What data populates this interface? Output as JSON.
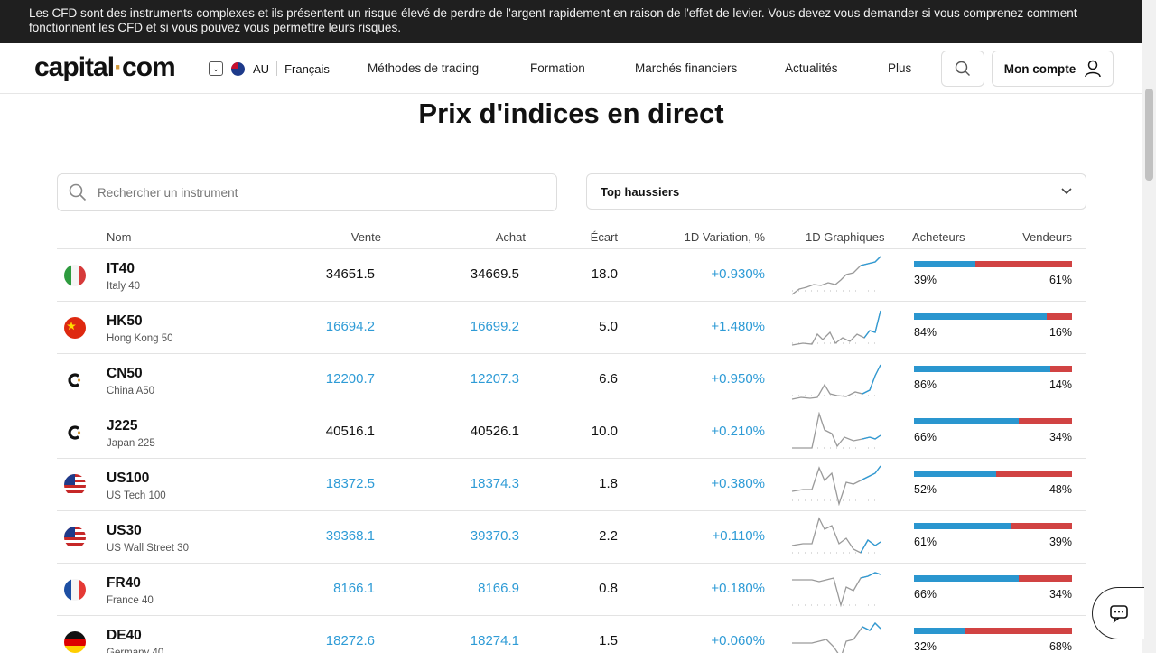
{
  "banner": {
    "text": "Les CFD sont des instruments complexes et ils présentent un risque élevé de perdre de l'argent rapidement en raison de l'effet de levier. Vous devez vous demander si vous comprenez comment fonctionnent les CFD et si vous pouvez vous permettre leurs risques."
  },
  "header": {
    "logo_main": "capital",
    "logo_dot": "·",
    "logo_end": "com",
    "region": "AU",
    "language": "Français",
    "nav": [
      "Méthodes de trading",
      "Formation",
      "Marchés financiers",
      "Actualités",
      "Plus"
    ],
    "account": "Mon compte"
  },
  "page": {
    "title": "Prix d'indices en direct",
    "search_placeholder": "Rechercher un instrument",
    "filter_value": "Top haussiers"
  },
  "table": {
    "headers": {
      "name": "Nom",
      "sell": "Vente",
      "buy": "Achat",
      "spread": "Écart",
      "change": "1D Variation, %",
      "chart": "1D Graphiques",
      "buyers": "Acheteurs",
      "sellers": "Vendeurs"
    },
    "rows": [
      {
        "symbol": "IT40",
        "name": "Italy 40",
        "flag": "italy",
        "sell": "34651.5",
        "buy": "34669.5",
        "spread": "18.0",
        "change": "+0.930%",
        "buyers_pct": 39,
        "sellers_pct": 61,
        "buyers": "39%",
        "sellers": "61%",
        "price_color": "dark"
      },
      {
        "symbol": "HK50",
        "name": "Hong Kong 50",
        "flag": "china",
        "sell": "16694.2",
        "buy": "16699.2",
        "spread": "5.0",
        "change": "+1.480%",
        "buyers_pct": 84,
        "sellers_pct": 16,
        "buyers": "84%",
        "sellers": "16%",
        "price_color": "blue"
      },
      {
        "symbol": "CN50",
        "name": "China A50",
        "flag": "capital-c",
        "sell": "12200.7",
        "buy": "12207.3",
        "spread": "6.6",
        "change": "+0.950%",
        "buyers_pct": 86,
        "sellers_pct": 14,
        "buyers": "86%",
        "sellers": "14%",
        "price_color": "blue"
      },
      {
        "symbol": "J225",
        "name": "Japan 225",
        "flag": "capital-c",
        "sell": "40516.1",
        "buy": "40526.1",
        "spread": "10.0",
        "change": "+0.210%",
        "buyers_pct": 66,
        "sellers_pct": 34,
        "buyers": "66%",
        "sellers": "34%",
        "price_color": "dark"
      },
      {
        "symbol": "US100",
        "name": "US Tech 100",
        "flag": "usa",
        "sell": "18372.5",
        "buy": "18374.3",
        "spread": "1.8",
        "change": "+0.380%",
        "buyers_pct": 52,
        "sellers_pct": 48,
        "buyers": "52%",
        "sellers": "48%",
        "price_color": "blue"
      },
      {
        "symbol": "US30",
        "name": "US Wall Street 30",
        "flag": "usa",
        "sell": "39368.1",
        "buy": "39370.3",
        "spread": "2.2",
        "change": "+0.110%",
        "buyers_pct": 61,
        "sellers_pct": 39,
        "buyers": "61%",
        "sellers": "39%",
        "price_color": "blue"
      },
      {
        "symbol": "FR40",
        "name": "France 40",
        "flag": "france",
        "sell": "8166.1",
        "buy": "8166.9",
        "spread": "0.8",
        "change": "+0.180%",
        "buyers_pct": 66,
        "sellers_pct": 34,
        "buyers": "66%",
        "sellers": "34%",
        "price_color": "blue"
      },
      {
        "symbol": "DE40",
        "name": "Germany 40",
        "flag": "germany",
        "sell": "18272.6",
        "buy": "18274.1",
        "spread": "1.5",
        "change": "+0.060%",
        "buyers_pct": 32,
        "sellers_pct": 68,
        "buyers": "32%",
        "sellers": "68%",
        "price_color": "blue"
      }
    ]
  },
  "colors": {
    "buyers": "#2a96cf",
    "sellers": "#d14343",
    "positive": "#2e9bd6",
    "banner_bg": "#1f1f1f"
  }
}
